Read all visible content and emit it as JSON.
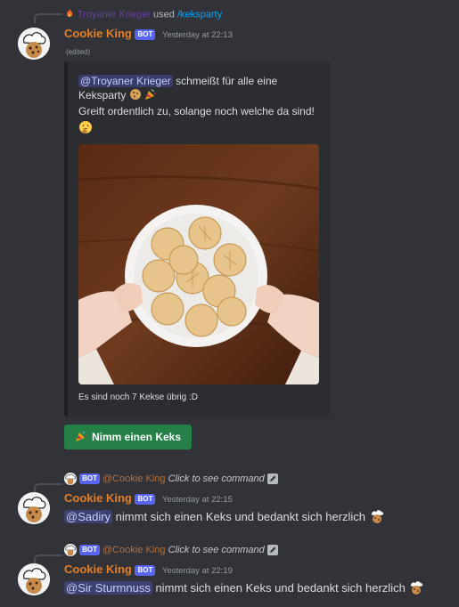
{
  "message1": {
    "reply": {
      "user": "Troyaner Krieger",
      "used": "used",
      "command": "/keksparty"
    },
    "author": "Cookie King",
    "bot_tag": "BOT",
    "timestamp": "Yesterday at 22:13",
    "edited": "(edited)",
    "embed": {
      "mention": "@Troyaner Krieger",
      "line1_rest": "schmeißt für alle eine",
      "line2": "Keksparty",
      "line3": "Greift ordentlich zu, solange noch welche da sind!",
      "footer": "Es sind noch 7 Kekse übrig :D",
      "border_color": "#1e1f22"
    },
    "button_label": "Nimm einen Keks"
  },
  "message2": {
    "reply": {
      "bot_tag": "BOT",
      "mention": "@Cookie King",
      "hint": "Click to see command"
    },
    "author": "Cookie King",
    "bot_tag": "BOT",
    "timestamp": "Yesterday at 22:15",
    "mention": "@Sadiry",
    "text": "nimmt sich einen Keks und bedankt sich herzlich"
  },
  "message3": {
    "reply": {
      "bot_tag": "BOT",
      "mention": "@Cookie King",
      "hint": "Click to see command"
    },
    "author": "Cookie King",
    "bot_tag": "BOT",
    "timestamp": "Yesterday at 22:19",
    "mention": "@Sir Sturmnuss",
    "text": "nimmt sich einen Keks und bedankt sich herzlich"
  },
  "colors": {
    "background": "#313338",
    "author": "#e67e22",
    "bot_tag": "#5865f2",
    "button": "#248046",
    "link": "#00a8fc"
  },
  "icons": [
    "fire-icon",
    "cookie-king-avatar",
    "cookie-emoji",
    "party-popper-emoji",
    "thinking-emoji",
    "chef-emoji",
    "edit-icon"
  ]
}
